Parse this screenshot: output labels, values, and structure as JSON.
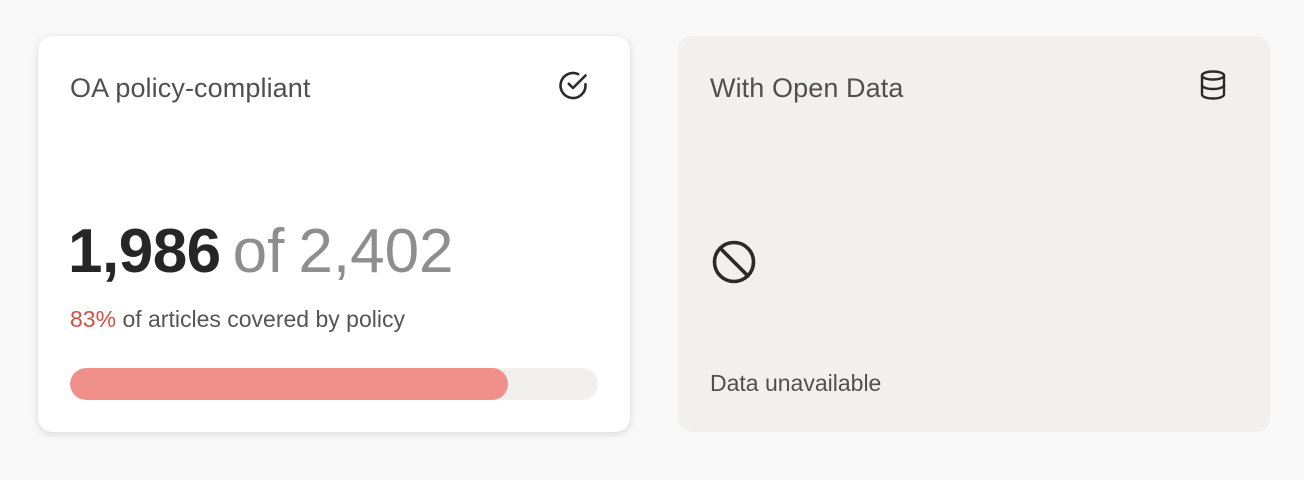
{
  "cards": {
    "compliant": {
      "title": "OA policy-compliant",
      "icon": "check-circle-icon",
      "value": "1,986",
      "of_word": "of",
      "total": "2,402",
      "percent": "83%",
      "description": "of articles covered by policy",
      "progress_fraction": 0.83,
      "progress_color": "#f0908a",
      "accent_color": "#d24f44"
    },
    "open_data": {
      "title": "With Open Data",
      "icon": "database-icon",
      "status_icon": "unavailable-icon",
      "status_text": "Data unavailable"
    }
  }
}
